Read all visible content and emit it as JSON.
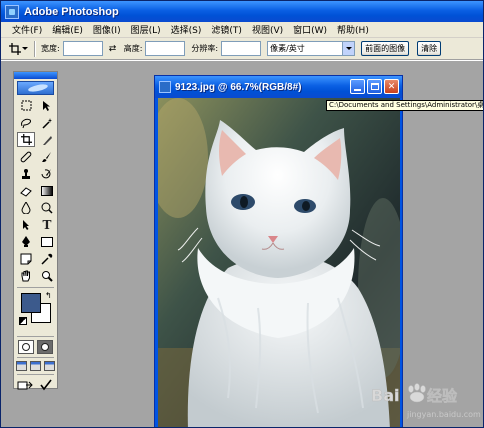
{
  "app": {
    "title": "Adobe Photoshop",
    "icon": "photoshop-app-icon"
  },
  "menu": {
    "items": [
      "文件(F)",
      "编辑(E)",
      "图像(I)",
      "图层(L)",
      "选择(S)",
      "滤镜(T)",
      "视图(V)",
      "窗口(W)",
      "帮助(H)"
    ]
  },
  "options": {
    "tool_icon": "crop-tool-icon",
    "width_label": "宽度:",
    "width_value": "",
    "swap_icon": "swap-arrows-icon",
    "height_label": "高度:",
    "height_value": "",
    "resolution_label": "分辨率:",
    "resolution_value": "",
    "unit_value": "像素/英寸",
    "front_image_button": "前面的图像",
    "clear_button": "清除"
  },
  "document": {
    "title": "9123.jpg @ 66.7%(RGB/8#)",
    "path_tooltip": "C:\\Documents and Settings\\Administrator\\桌"
  },
  "toolbox": {
    "tools": [
      "rectangular-marquee-icon",
      "move-icon",
      "lasso-icon",
      "magic-wand-icon",
      "crop-icon",
      "slice-icon",
      "healing-brush-icon",
      "brush-icon",
      "clone-stamp-icon",
      "history-brush-icon",
      "eraser-icon",
      "gradient-icon",
      "blur-icon",
      "dodge-icon",
      "path-selection-icon",
      "type-icon",
      "pen-icon",
      "rectangle-shape-icon",
      "notes-icon",
      "eyedropper-icon",
      "hand-icon",
      "zoom-icon"
    ],
    "foreground_color": "#3c5a8c",
    "background_color": "#ffffff"
  },
  "watermark": {
    "brand": "Baidu经验",
    "url": "jingyan.baidu.com"
  }
}
